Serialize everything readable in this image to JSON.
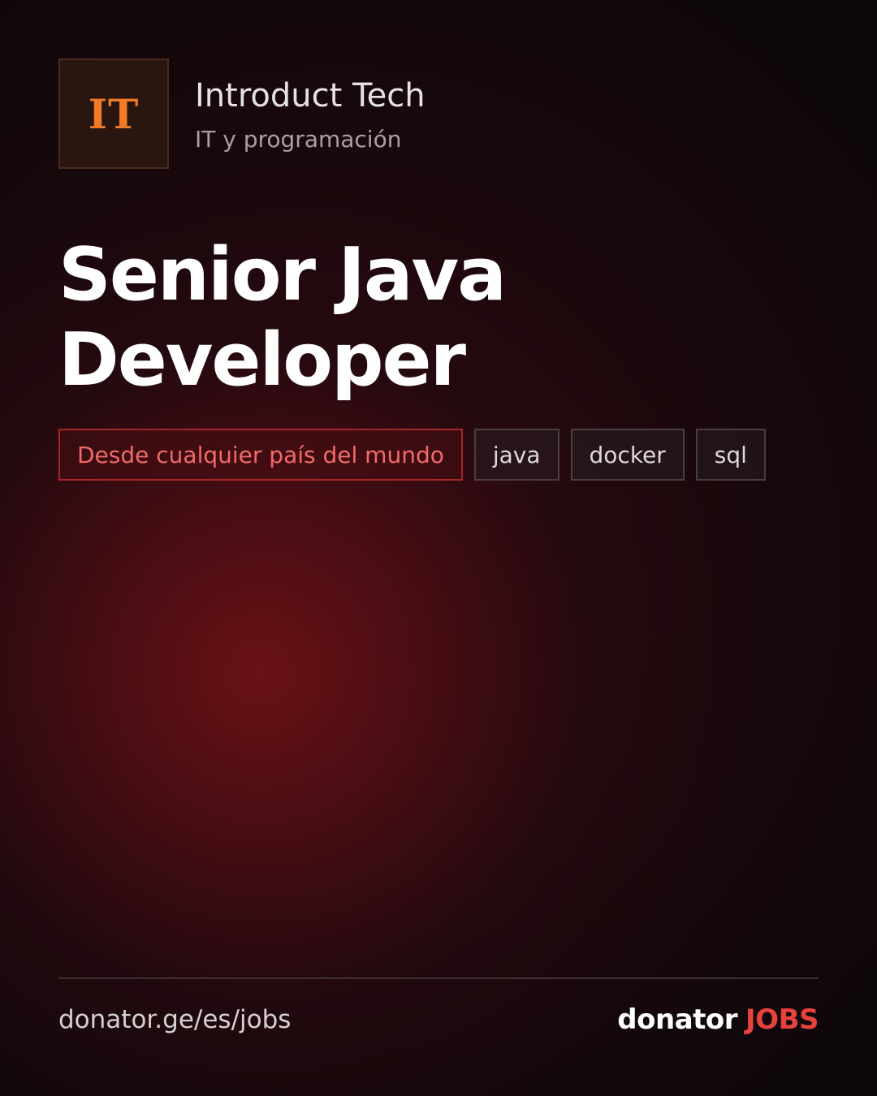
{
  "company": {
    "logo_text": "IT",
    "name": "Introduct Tech",
    "category": "IT y programación"
  },
  "job": {
    "title_line1": "Senior Java",
    "title_line2": "Developer"
  },
  "tags": {
    "location": "Desde cualquier país del mundo",
    "skills": [
      "java",
      "docker",
      "sql"
    ]
  },
  "footer": {
    "url": "donator.ge/es/jobs",
    "brand_name": "donator",
    "brand_suffix": "JOBS"
  },
  "colors": {
    "accent": "#e8413e",
    "logo_accent": "#f07a26",
    "background": "#0c0709"
  }
}
